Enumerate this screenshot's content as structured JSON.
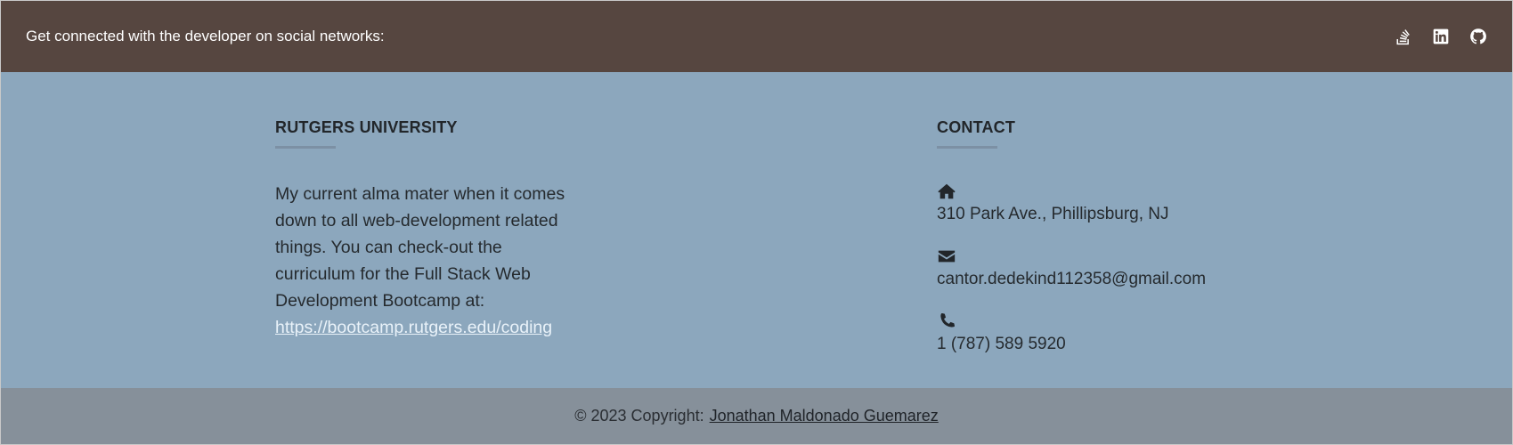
{
  "topbar": {
    "text": "Get connected with the developer on social networks:",
    "social": [
      {
        "icon": "stack-overflow-icon"
      },
      {
        "icon": "linkedin-icon"
      },
      {
        "icon": "github-icon"
      }
    ]
  },
  "left": {
    "heading": "RUTGERS UNIVERSITY",
    "text": "My current alma mater when it comes down to all web-development related things. You can check-out the curriculum for the Full Stack Web Development Bootcamp at:",
    "link": "https://bootcamp.rutgers.edu/coding"
  },
  "right": {
    "heading": "CONTACT",
    "items": [
      {
        "icon": "home-icon",
        "text": "310 Park Ave., Phillipsburg, NJ"
      },
      {
        "icon": "envelope-icon",
        "text": "cantor.dedekind112358@gmail.com"
      },
      {
        "icon": "phone-icon",
        "text": "1 (787) 589 5920"
      }
    ]
  },
  "footer": {
    "copyright": "© 2023 Copyright:",
    "author": "Jonathan Maldonado Guemarez"
  },
  "colors": {
    "topbar": "#564640",
    "main": "#8ca7bd",
    "footer": "#86909a",
    "link": "#e9f2f9"
  }
}
